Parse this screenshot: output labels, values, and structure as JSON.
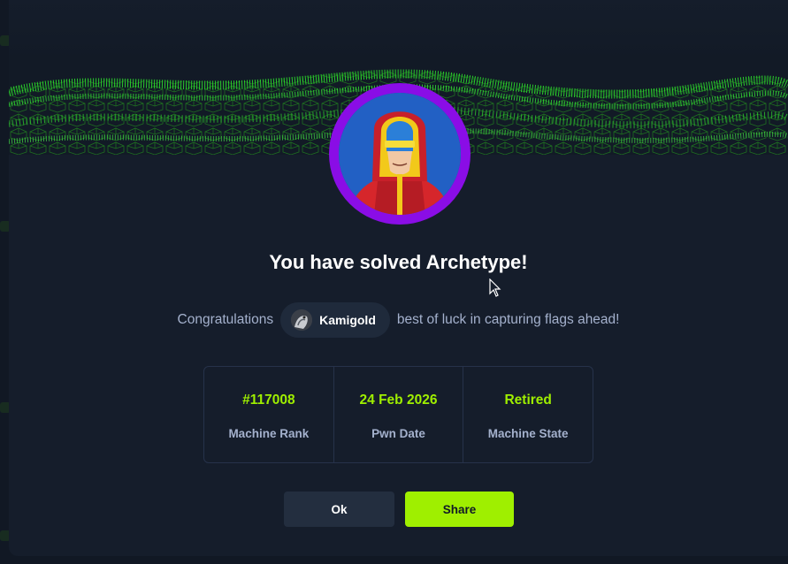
{
  "modal": {
    "title": "You have solved Archetype!",
    "congrats_prefix": "Congratulations",
    "user_name": "Kamigold",
    "congrats_suffix": "best of luck in capturing flags ahead!",
    "machine_avatar_icon": "hooded-hero-avatar",
    "user_avatar_icon": "user-avatar"
  },
  "stats": [
    {
      "value": "#117008",
      "label": "Machine Rank"
    },
    {
      "value": "24 Feb 2026",
      "label": "Pwn Date"
    },
    {
      "value": "Retired",
      "label": "Machine State"
    }
  ],
  "actions": {
    "ok_label": "Ok",
    "share_label": "Share"
  },
  "colors": {
    "accent": "#9fef00",
    "ring": "#8a0de6",
    "background": "#151d2b",
    "muted_text": "#a4b1cd"
  }
}
